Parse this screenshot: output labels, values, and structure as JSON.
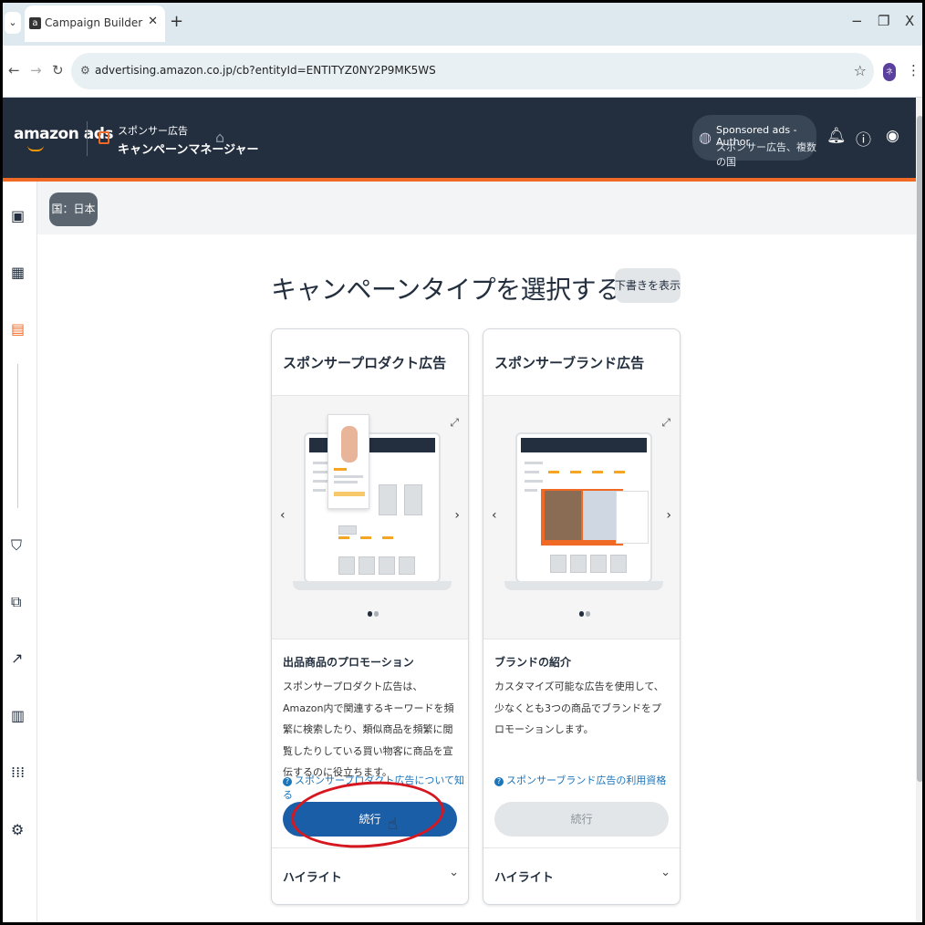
{
  "browser": {
    "tab_title": "Campaign Builder",
    "tab_favicon": "a",
    "url": "advertising.amazon.co.jp/cb?entityId=ENTITYZ0NY2P9MK5WS",
    "profile_initial": "ネ"
  },
  "header": {
    "logo": "amazon ads",
    "line1": "スポンサー広告",
    "line2": "キャンペーンマネージャー",
    "account_name": "Sponsored ads - Author",
    "account_scope": "スポンサー広告、複数の国"
  },
  "band": {
    "country": "国：日本"
  },
  "page": {
    "title": "キャンペーンタイプを選択する",
    "draft_button": "下書きを表示"
  },
  "cards": [
    {
      "title": "スポンサープロダクト広告",
      "heading": "出品商品のプロモーション",
      "description": "スポンサープロダクト広告は、Amazon内で関連するキーワードを頻繁に検索したり、類似商品を頻繁に閲覧したりしている買い物客に商品を宣伝するのに役立ちます。",
      "link": "スポンサープロダクト広告について知る",
      "button": "続行",
      "highlights": "ハイライト"
    },
    {
      "title": "スポンサーブランド広告",
      "heading": "ブランドの紹介",
      "description": "カスタマイズ可能な広告を使用して、少なくとも3つの商品でブランドをプロモーションします。",
      "link": "スポンサーブランド広告の利用資格",
      "button": "続行",
      "highlights": "ハイライト"
    }
  ],
  "colors": {
    "header_bg": "#232f3e",
    "accent": "#f06a25",
    "primary_button": "#1b5ea8",
    "link": "#1b75bb",
    "annotation": "#d6171f"
  }
}
